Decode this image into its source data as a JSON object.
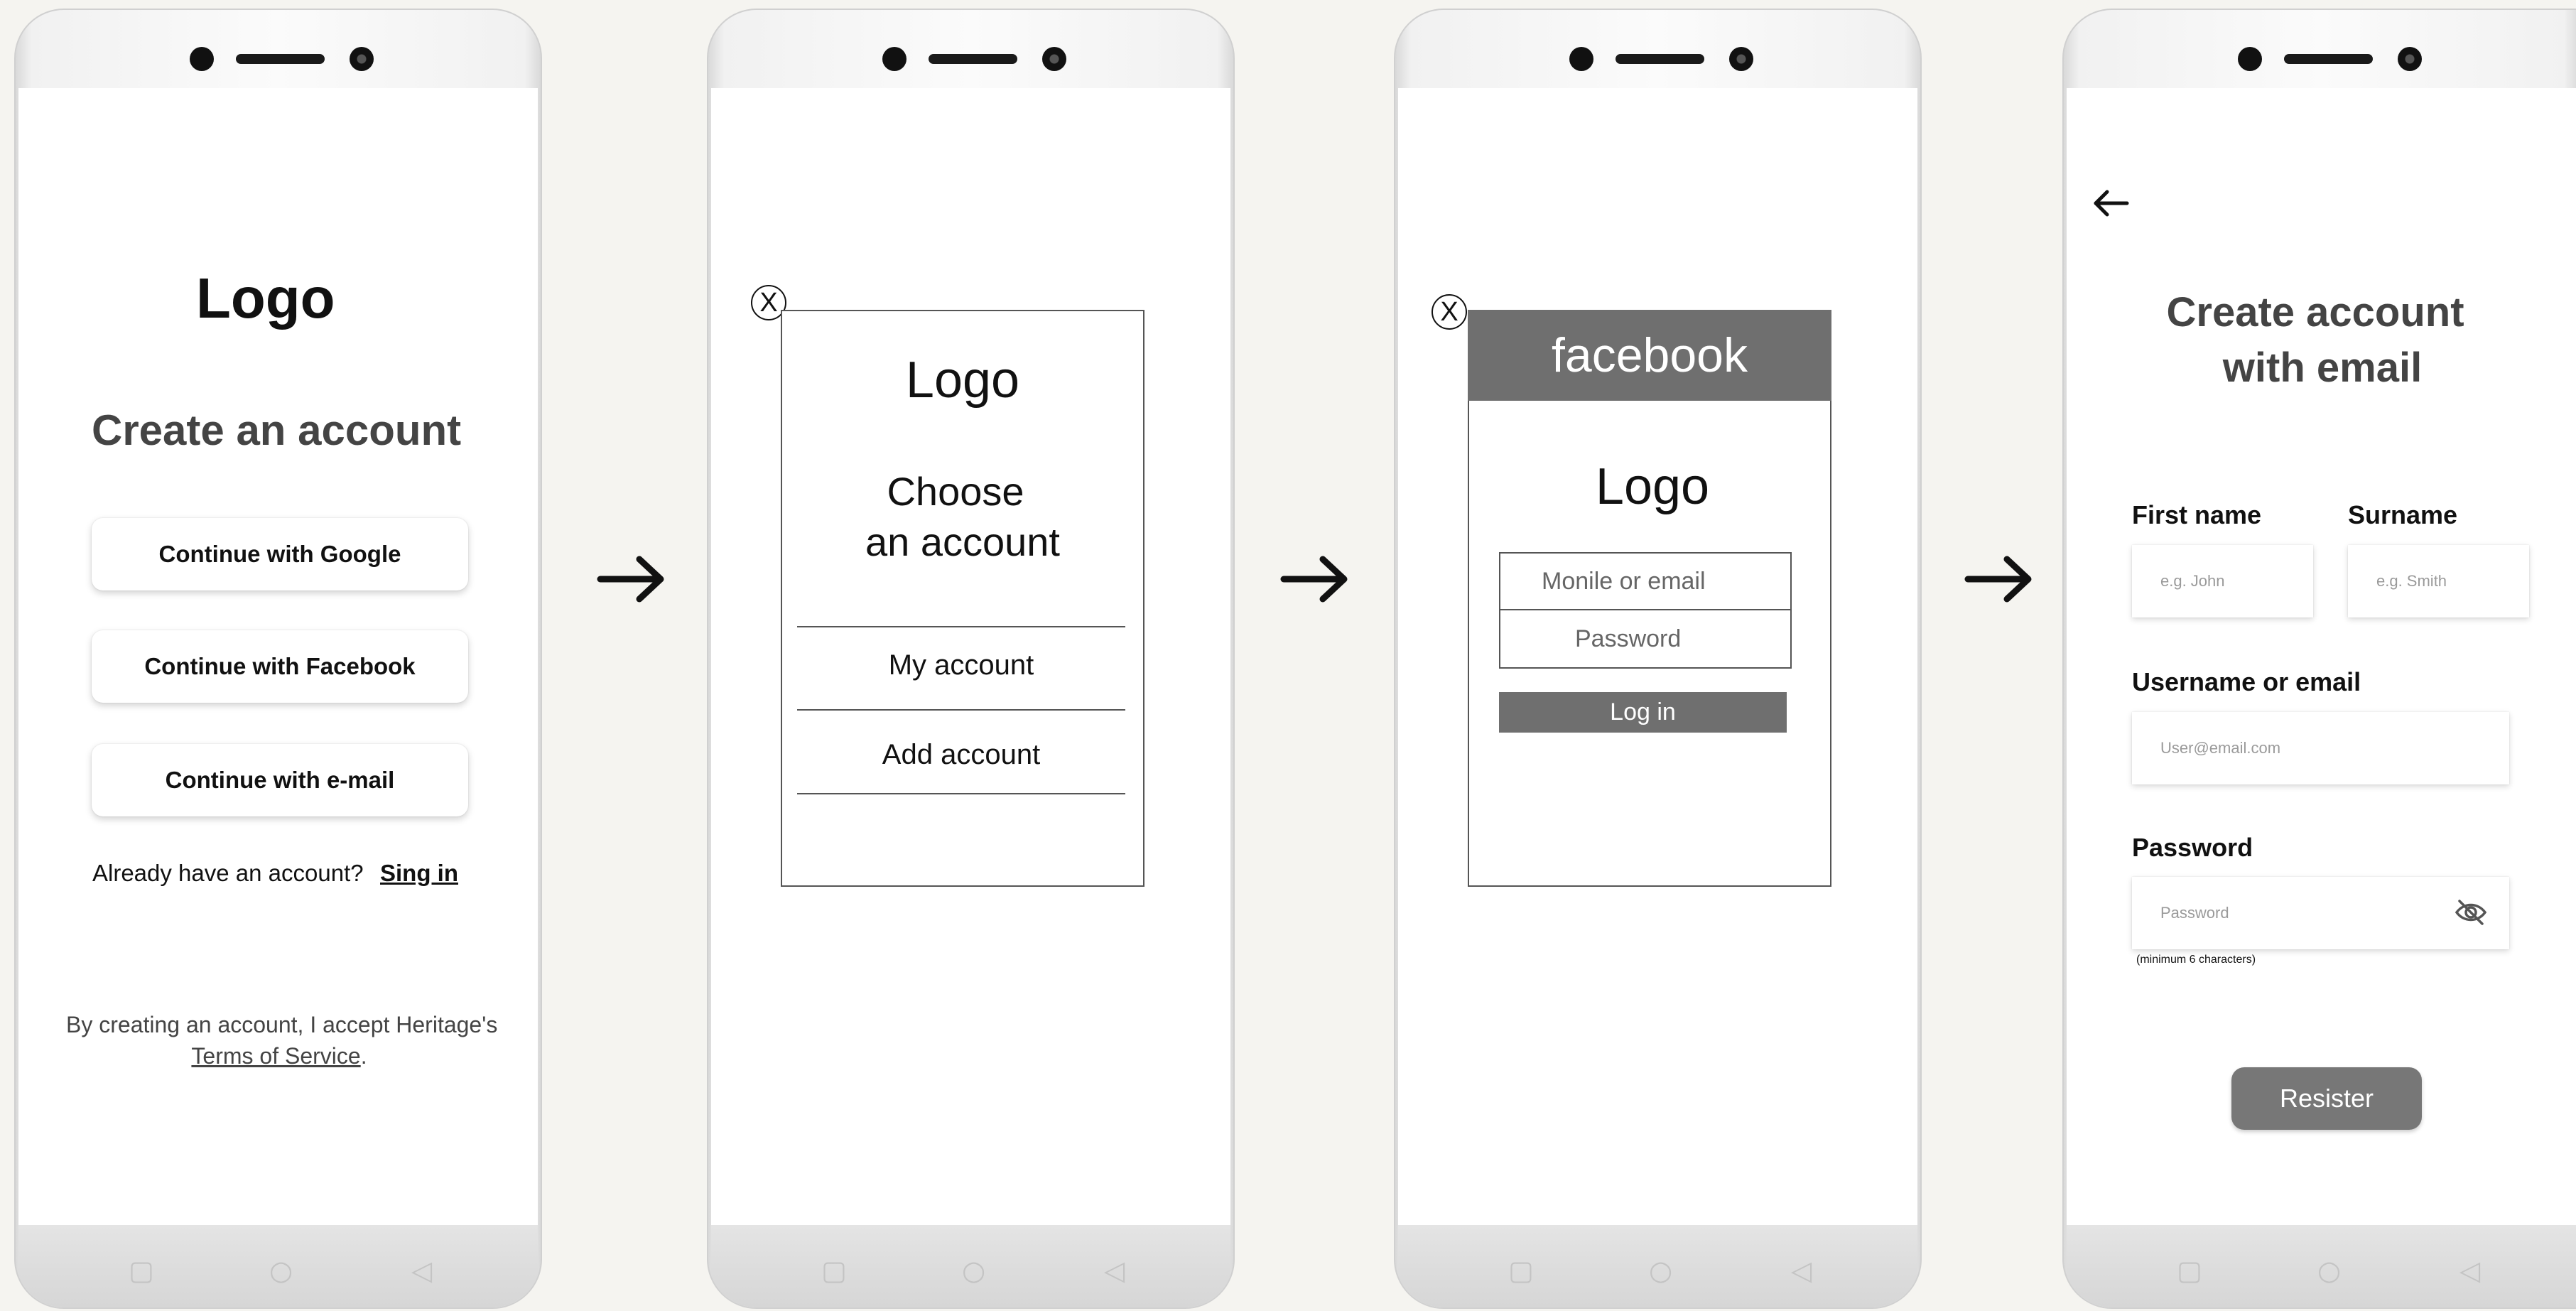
{
  "screen1": {
    "logo": "Logo",
    "title": "Create an account",
    "btn_google": "Continue with Google",
    "btn_facebook": "Continue with Facebook",
    "btn_email": "Continue with e-mail",
    "already": "Already have an account?",
    "signin": "Sing in",
    "terms_line1": "By creating an account, I accept Heritage's",
    "terms_link": "Terms of Service",
    "terms_period": "."
  },
  "screen2": {
    "close": "X",
    "logo": "Logo",
    "choose_line1": "Choose",
    "choose_line2": "an account",
    "my_account": "My account",
    "add_account": "Add account"
  },
  "screen3": {
    "close": "X",
    "header": "facebook",
    "logo": "Logo",
    "login_placeholder": "Monile or email",
    "password_placeholder": "Password",
    "login_button": "Log in"
  },
  "screen4": {
    "title_line1": "Create account",
    "title_line2": "with email",
    "first_name_label": "First name",
    "first_name_placeholder": "e.g. John",
    "surname_label": "Surname",
    "surname_placeholder": "e.g. Smith",
    "username_label": "Username or email",
    "username_placeholder": "User@email.com",
    "password_label": "Password",
    "password_placeholder": "Password",
    "password_hint": "(minimum 6 characters)",
    "register_button": "Resister"
  },
  "icons": {
    "back": "arrow-left-icon",
    "eye": "eye-hidden-icon",
    "flow_arrow": "arrow-right-icon"
  },
  "colors": {
    "facebook_header": "#6f6f6f",
    "login_button": "#6f6f6f",
    "register_button": "#777777"
  }
}
